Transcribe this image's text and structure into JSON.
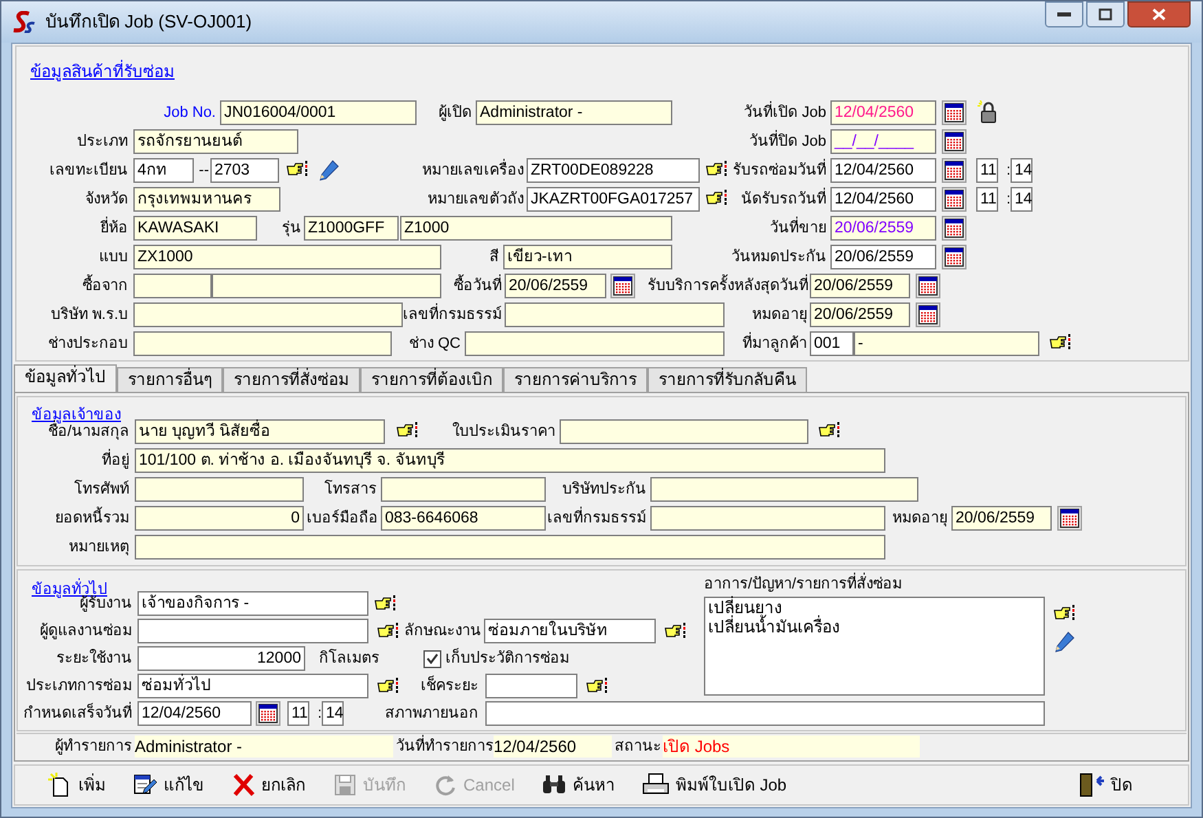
{
  "window": {
    "title": "บันทึกเปิด Job (SV-OJ001)"
  },
  "product": {
    "heading": "ข้อมูลสินค้าที่รับซ่อม",
    "job_no": {
      "label": "Job No.",
      "value": "JN016004/0001"
    },
    "opened_by": {
      "label": "ผู้เปิด",
      "value": "Administrator -"
    },
    "open_date": {
      "label": "วันที่เปิด Job",
      "value": "12/04/2560"
    },
    "close_date": {
      "label": "วันที่ปิด Job",
      "value": "__/__/____"
    },
    "type": {
      "label": "ประเภท",
      "value": "รถจักรยานยนต์"
    },
    "plate": {
      "label": "เลขทะเบียน",
      "prefix": "4กท",
      "separator": "--",
      "number": "2703"
    },
    "engine_no": {
      "label": "หมายเลขเครื่อง",
      "value": "ZRT00DE089228"
    },
    "receive_date": {
      "label": "รับรถซ่อมวันที่",
      "value": "12/04/2560",
      "hour": "11",
      "separator": ":",
      "minute": "14"
    },
    "province": {
      "label": "จังหวัด",
      "value": "กรุงเทพมหานคร"
    },
    "chassis_no": {
      "label": "หมายเลขตัวถัง",
      "value": "JKAZRT00FGA017257"
    },
    "pickup_date": {
      "label": "นัดรับรถวันที่",
      "value": "12/04/2560",
      "hour": "11",
      "separator": ":",
      "minute": "14"
    },
    "brand": {
      "label": "ยี่ห้อ",
      "value": "KAWASAKI"
    },
    "model": {
      "label": "รุ่น",
      "code": "Z1000GFF",
      "name": "Z1000"
    },
    "sale_date": {
      "label": "วันที่ขาย",
      "value": "20/06/2559"
    },
    "style": {
      "label": "แบบ",
      "value": "ZX1000"
    },
    "paint": {
      "label": "สี",
      "value": "เขียว-เทา"
    },
    "warranty_end": {
      "label": "วันหมดประกัน",
      "value": "20/06/2559"
    },
    "bought_from": {
      "label": "ซื้อจาก"
    },
    "purchase_date": {
      "label": "ซื้อวันที่",
      "value": "20/06/2559"
    },
    "last_service": {
      "label": "รับบริการครั้งหลังสุดวันที่",
      "value": "20/06/2559"
    },
    "insurer": {
      "label": "บริษัท พ.ร.บ"
    },
    "policy_no": {
      "label": "เลขที่กรมธรรม์"
    },
    "expiry": {
      "label": "หมดอายุ",
      "value": "20/06/2559"
    },
    "assembler": {
      "label": "ช่างประกอบ"
    },
    "qc": {
      "label": "ช่าง QC"
    },
    "source": {
      "label": "ที่มาลูกค้า",
      "code": "001",
      "name": "-"
    }
  },
  "tabs": [
    {
      "label": "ข้อมูลทั่วไป",
      "selected": true
    },
    {
      "label": "รายการอื่นๆ",
      "selected": false
    },
    {
      "label": "รายการที่สั่งซ่อม",
      "selected": false
    },
    {
      "label": "รายการที่ต้องเบิก",
      "selected": false
    },
    {
      "label": "รายการค่าบริการ",
      "selected": false
    },
    {
      "label": "รายการที่รับกลับคืน",
      "selected": false
    }
  ],
  "owner": {
    "heading": "ข้อมูลเจ้าของ",
    "name": {
      "label": "ชื่อ/นามสกุล",
      "value": "นาย บุญทวี นิสัยซื่อ"
    },
    "quote": {
      "label": "ใบประเมินราคา"
    },
    "address": {
      "label": "ที่อยู่",
      "value": "101/100 ต. ท่าช้าง อ. เมืองจันทบุรี จ. จันทบุรี"
    },
    "phone": {
      "label": "โทรศัพท์"
    },
    "fax": {
      "label": "โทรสาร"
    },
    "insurance": {
      "label": "บริษัทประกัน"
    },
    "debt": {
      "label": "ยอดหนี้รวม",
      "value": "0"
    },
    "mobile": {
      "label": "เบอร์มือถือ",
      "value": "083-6646068"
    },
    "policy_no": {
      "label": "เลขที่กรมธรรม์"
    },
    "expiry": {
      "label": "หมดอายุ",
      "value": "20/06/2559"
    },
    "note": {
      "label": "หมายเหตุ"
    }
  },
  "general": {
    "heading": "ข้อมูลทั่วไป",
    "receiver": {
      "label": "ผู้รับงาน",
      "value": "เจ้าของกิจการ -"
    },
    "supervisor": {
      "label": "ผู้ดูแลงานซ่อม"
    },
    "job_nature": {
      "label": "ลักษณะงาน",
      "value": "ซ่อมภายในบริษัท"
    },
    "mileage": {
      "label": "ระยะใช้งาน",
      "value": "12000",
      "unit": "กิโลเมตร"
    },
    "keep_history": {
      "label": "เก็บประวัติการซ่อม",
      "checked": true
    },
    "repair_type": {
      "label": "ประเภทการซ่อม",
      "value": "ซ่อมทั่วไป"
    },
    "check_interval": {
      "label": "เช็คระยะ"
    },
    "due": {
      "label": "กำหนดเสร็จวันที่",
      "value": "12/04/2560",
      "hour": "11",
      "separator": ":",
      "minute": "14"
    },
    "exterior": {
      "label": "สภาพภายนอก"
    },
    "symptoms": {
      "label": "อาการ/ปัญหา/รายการที่สั่งซ่อม",
      "lines": [
        "เปลี่ยนยาง",
        "เปลี่ยนน้ำมันเครื่อง"
      ]
    }
  },
  "record_bar": {
    "by_label": "ผู้ทำรายการ",
    "by": "Administrator -",
    "date_label": "วันที่ทำรายการ",
    "date": "12/04/2560",
    "status_label": "สถานะ",
    "status": "เปิด Jobs"
  },
  "buttons": [
    {
      "kind": "new",
      "label": "เพิ่ม",
      "disabled": false
    },
    {
      "kind": "edit",
      "label": "แก้ไข",
      "disabled": false
    },
    {
      "kind": "cancel",
      "label": "ยกเลิก",
      "disabled": false
    },
    {
      "kind": "save",
      "label": "บันทึก",
      "disabled": true
    },
    {
      "kind": "undo",
      "label": "Cancel",
      "disabled": true
    },
    {
      "kind": "search",
      "label": "ค้นหา",
      "disabled": false
    },
    {
      "kind": "print",
      "label": "พิมพ์ใบเปิด Job",
      "disabled": false
    },
    {
      "kind": "exit",
      "label": "ปิด",
      "disabled": false
    }
  ]
}
